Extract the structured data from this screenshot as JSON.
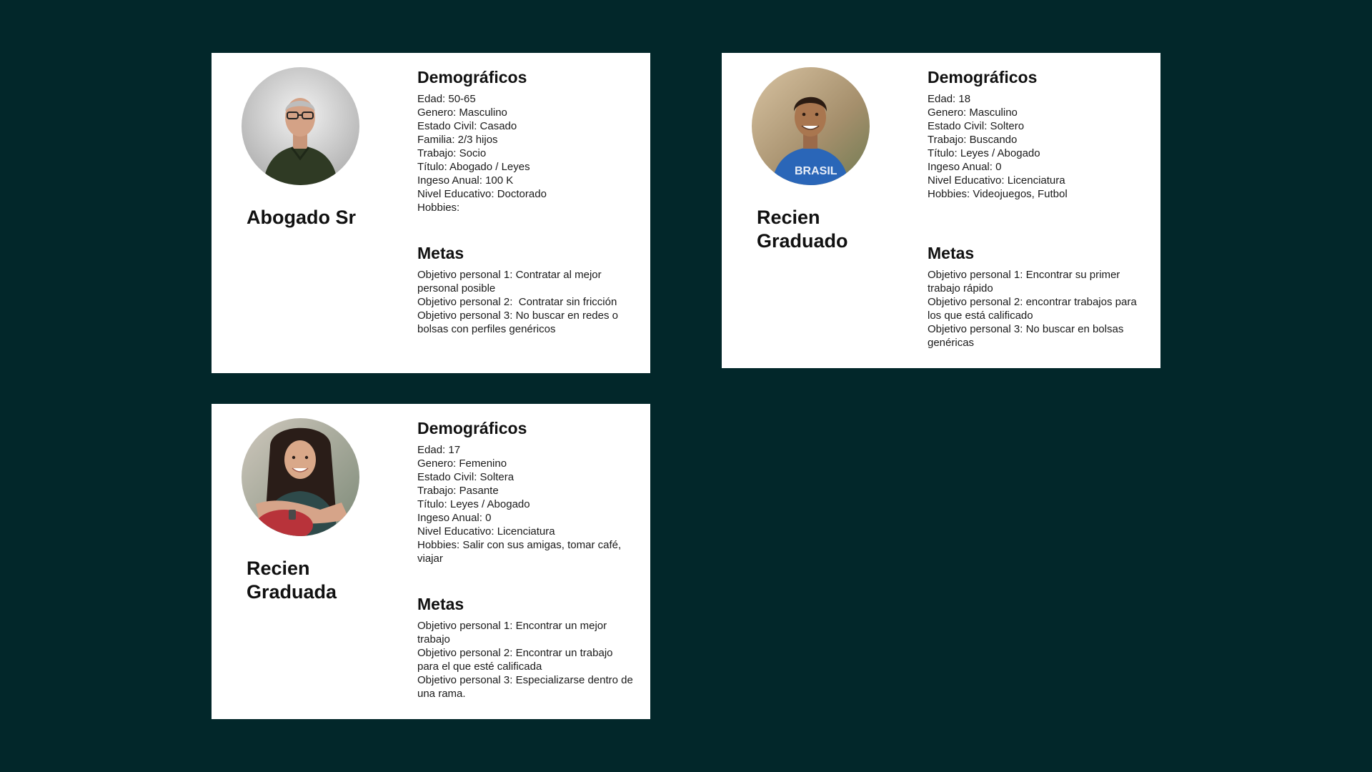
{
  "personas": [
    {
      "name": "Abogado Sr",
      "demographics_title": "Demográficos",
      "demographics": [
        "Edad: 50-65",
        "Genero: Masculino",
        "Estado Civil: Casado",
        "Familia: 2/3 hijos",
        "Trabajo: Socio",
        "Título: Abogado / Leyes",
        "Ingeso Anual: 100 K",
        "Nivel Educativo: Doctorado",
        "Hobbies:"
      ],
      "goals_title": "Metas",
      "goals": [
        "Objetivo personal 1: Contratar al mejor personal posible",
        "Objetivo personal 2:  Contratar sin fricción",
        "Objetivo personal 3: No buscar en redes o bolsas con perfiles genéricos"
      ]
    },
    {
      "name": "Recien\nGraduado",
      "demographics_title": "Demográficos",
      "demographics": [
        "Edad: 18",
        "Genero: Masculino",
        "Estado Civil: Soltero",
        "Trabajo: Buscando",
        "Título: Leyes / Abogado",
        "Ingeso Anual: 0",
        "Nivel Educativo: Licenciatura",
        "Hobbies: Videojuegos, Futbol"
      ],
      "goals_title": "Metas",
      "goals": [
        "Objetivo personal 1: Encontrar su primer trabajo rápido",
        "Objetivo personal 2: encontrar trabajos para los que está calificado",
        "Objetivo personal 3: No buscar en bolsas genéricas"
      ]
    },
    {
      "name": "Recien\nGraduada",
      "demographics_title": "Demográficos",
      "demographics": [
        "Edad: 17",
        "Genero: Femenino",
        "Estado Civil: Soltera",
        "Trabajo: Pasante",
        "Título: Leyes / Abogado",
        "Ingeso Anual: 0",
        "Nivel Educativo: Licenciatura",
        "Hobbies: Salir con sus amigas, tomar café, viajar"
      ],
      "goals_title": "Metas",
      "goals": [
        "Objetivo personal 1: Encontrar un mejor trabajo",
        "Objetivo personal 2: Encontrar un trabajo para el que esté calificada",
        "Objetivo personal 3: Especializarse dentro de una rama."
      ]
    }
  ],
  "colors": {
    "background": "#02272a",
    "card": "#ffffff",
    "text": "#111111"
  }
}
